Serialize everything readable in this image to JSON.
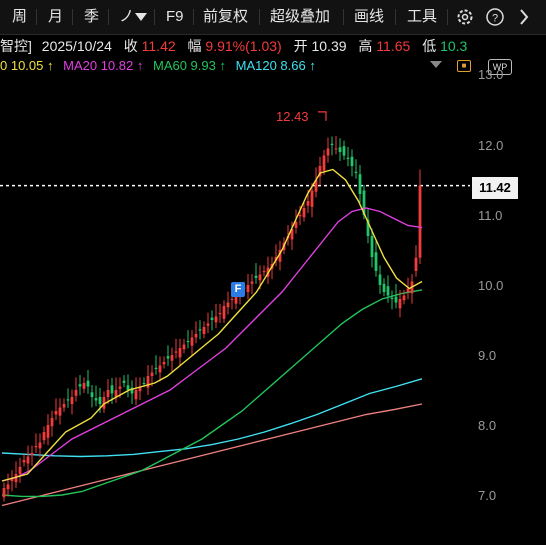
{
  "toolbar": {
    "items": [
      "周",
      "月",
      "季",
      "ノ",
      "F9",
      "前复权",
      "超级叠加",
      "画线",
      "工具"
    ]
  },
  "info": {
    "name": "智控]",
    "date": "2025/10/24",
    "close_label": "收",
    "close": "11.42",
    "change_label": "幅",
    "change": "9.91%(1.03)",
    "open_label": "开",
    "open": "10.39",
    "high_label": "高",
    "high": "11.65",
    "low_label": "低",
    "low": "10.3"
  },
  "ma_legend": {
    "ma10": "0 10.05",
    "ma20": "MA20 10.82",
    "ma60": "MA60 9.93",
    "ma120": "MA120 8.66",
    "arrow": "↑"
  },
  "colors": {
    "up": "#f23b3b",
    "down": "#21c46a",
    "ma10": "#f0e040",
    "ma20": "#e040e0",
    "ma60": "#22c45a",
    "ma120": "#40e0f0",
    "ma250": "#f08080",
    "background": "#000000"
  },
  "chart_data": {
    "type": "candlestick",
    "y_ticks": [
      "13.0",
      "12.0",
      "11.0",
      "10.0",
      "9.0",
      "8.0",
      "7.0"
    ],
    "ylim": [
      6.85,
      13.2
    ],
    "last_price": "11.42",
    "high_marker": "12.43",
    "event_badge": "F",
    "closes": [
      7.1,
      7.15,
      7.25,
      7.3,
      7.4,
      7.5,
      7.55,
      7.6,
      7.7,
      7.75,
      7.9,
      8.0,
      8.1,
      8.2,
      8.25,
      8.3,
      8.35,
      8.4,
      8.5,
      8.55,
      8.6,
      8.55,
      8.4,
      8.35,
      8.3,
      8.4,
      8.5,
      8.45,
      8.5,
      8.55,
      8.6,
      8.5,
      8.45,
      8.5,
      8.55,
      8.6,
      8.7,
      8.75,
      8.8,
      8.85,
      8.9,
      8.95,
      9.0,
      9.05,
      9.1,
      9.15,
      9.2,
      9.25,
      9.3,
      9.35,
      9.4,
      9.45,
      9.5,
      9.55,
      9.6,
      9.7,
      9.75,
      9.8,
      9.85,
      9.9,
      9.95,
      10.0,
      10.05,
      10.1,
      10.15,
      10.2,
      10.25,
      10.3,
      10.4,
      10.5,
      10.6,
      10.7,
      10.8,
      10.9,
      11.0,
      11.1,
      11.2,
      11.35,
      11.5,
      11.7,
      11.85,
      11.95,
      12.0,
      11.95,
      11.9,
      11.85,
      11.8,
      11.7,
      11.6,
      11.3,
      11.0,
      10.7,
      10.4,
      10.2,
      10.0,
      9.9,
      9.85,
      9.8,
      9.75,
      9.8,
      9.85,
      9.95,
      10.05,
      10.39,
      11.42
    ],
    "ma10": [
      7.2,
      7.25,
      7.3,
      7.5,
      7.7,
      7.9,
      8.0,
      8.1,
      8.3,
      8.4,
      8.5,
      8.55,
      8.6,
      8.7,
      8.85,
      9.0,
      9.15,
      9.3,
      9.5,
      9.7,
      9.9,
      10.2,
      10.5,
      10.9,
      11.3,
      11.6,
      11.65,
      11.5,
      11.2,
      10.8,
      10.4,
      10.1,
      9.95,
      10.05
    ],
    "ma20": [
      7.2,
      7.25,
      7.35,
      7.5,
      7.65,
      7.8,
      7.9,
      8.0,
      8.1,
      8.2,
      8.3,
      8.4,
      8.5,
      8.65,
      8.8,
      8.95,
      9.1,
      9.3,
      9.5,
      9.7,
      9.9,
      10.15,
      10.4,
      10.65,
      10.9,
      11.05,
      11.1,
      11.05,
      10.95,
      10.85,
      10.82
    ],
    "ma60": [
      7.0,
      6.98,
      6.98,
      7.0,
      7.05,
      7.15,
      7.25,
      7.35,
      7.5,
      7.65,
      7.8,
      8.0,
      8.2,
      8.45,
      8.7,
      8.95,
      9.2,
      9.45,
      9.65,
      9.8,
      9.88,
      9.93
    ],
    "ma120": [
      7.6,
      7.58,
      7.56,
      7.55,
      7.56,
      7.58,
      7.62,
      7.66,
      7.72,
      7.8,
      7.9,
      8.02,
      8.15,
      8.3,
      8.45,
      8.55,
      8.66
    ],
    "ma250": [
      6.85,
      6.95,
      7.05,
      7.15,
      7.25,
      7.35,
      7.45,
      7.55,
      7.65,
      7.75,
      7.85,
      7.95,
      8.05,
      8.15,
      8.22,
      8.3
    ]
  }
}
